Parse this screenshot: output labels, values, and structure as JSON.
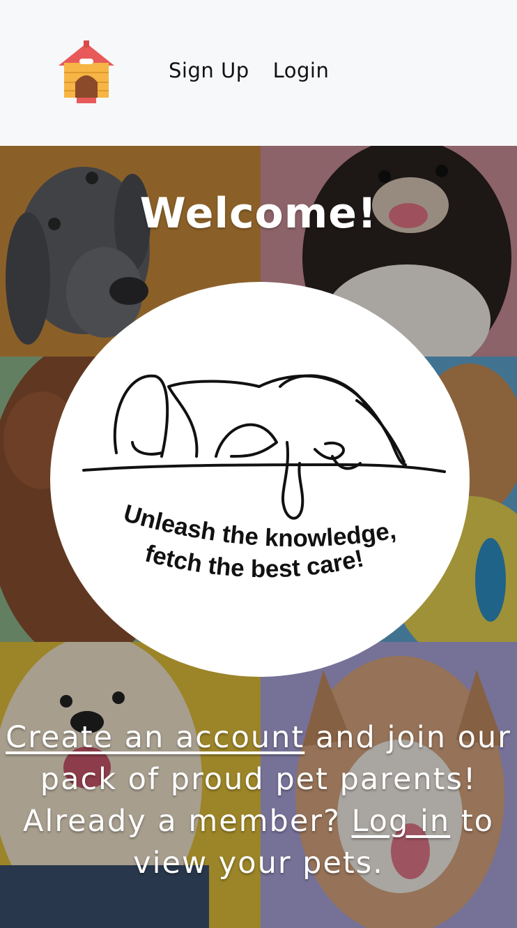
{
  "nav": {
    "logo_icon": "dog-house-icon",
    "links": [
      "Sign Up",
      "Login"
    ]
  },
  "hero": {
    "title": "Welcome!",
    "badge": {
      "line1": "Unleash the knowledge,",
      "line2": "fetch the best care!"
    },
    "cta": {
      "create_link": "Create an account",
      "text1": " and join our pack of proud pet parents! Already a member? ",
      "login_link": "Log in",
      "text2": " to view your pets."
    },
    "tile_colors": [
      "#c78a3a",
      "#c98f96",
      "#8fb78c",
      "#5ea5d0",
      "#e0bf3a",
      "#a9a3d9"
    ]
  }
}
